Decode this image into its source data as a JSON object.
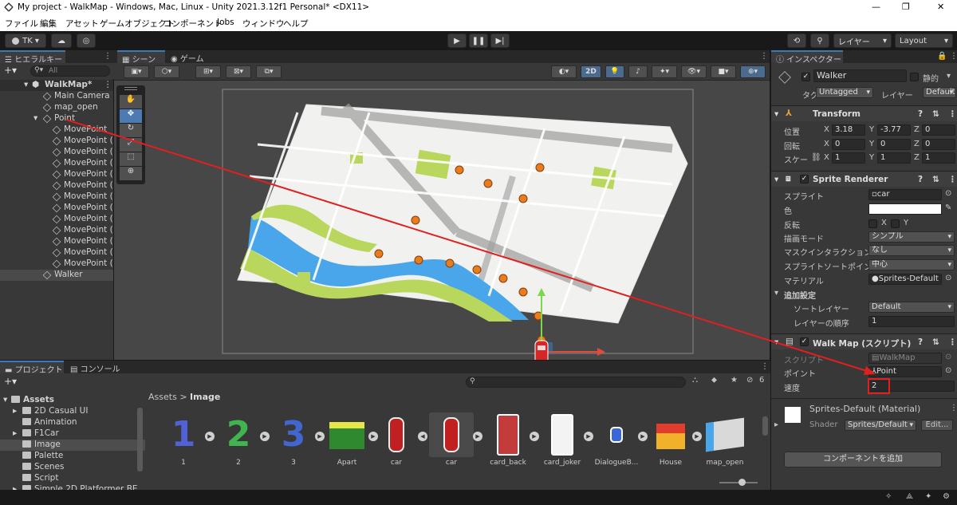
{
  "window": {
    "title": "My project - WalkMap - Windows, Mac, Linux - Unity 2021.3.12f1 Personal* <DX11>",
    "controls": [
      "—",
      "❐",
      "✕"
    ]
  },
  "menu": [
    "ファイル",
    "編集",
    "アセット",
    "ゲームオブジェクト",
    "コンポーネント",
    "Jobs",
    "ウィンドウ",
    "ヘルプ"
  ],
  "toolbar": {
    "account": "TK",
    "layers": "レイヤー",
    "layout": "Layout"
  },
  "hierarchy": {
    "tab": "ヒエラルキー",
    "search_placeholder": "All",
    "scene": "WalkMap*",
    "items": [
      {
        "label": "Main Camera",
        "indent": 1
      },
      {
        "label": "map_open",
        "indent": 1
      },
      {
        "label": "Point",
        "indent": 1
      },
      {
        "label": "MovePoint",
        "indent": 2
      },
      {
        "label": "MovePoint (",
        "indent": 2
      },
      {
        "label": "MovePoint (",
        "indent": 2
      },
      {
        "label": "MovePoint (",
        "indent": 2
      },
      {
        "label": "MovePoint (",
        "indent": 2
      },
      {
        "label": "MovePoint (",
        "indent": 2
      },
      {
        "label": "MovePoint (",
        "indent": 2
      },
      {
        "label": "MovePoint (",
        "indent": 2
      },
      {
        "label": "MovePoint (",
        "indent": 2
      },
      {
        "label": "MovePoint (",
        "indent": 2
      },
      {
        "label": "MovePoint (",
        "indent": 2
      },
      {
        "label": "MovePoint (",
        "indent": 2
      },
      {
        "label": "MovePoint (",
        "indent": 2
      },
      {
        "label": "Walker",
        "indent": 1
      }
    ]
  },
  "scene_view": {
    "tab_scene": "シーン",
    "tab_game": "ゲーム",
    "mode_2d": "2D"
  },
  "inspector": {
    "tab": "インスペクター",
    "object_name": "Walker",
    "static_label": "静的",
    "tag_label": "タグ",
    "tag_value": "Untagged",
    "layer_label": "レイヤー",
    "layer_value": "Default",
    "transform": {
      "title": "Transform",
      "position_label": "位置",
      "rotation_label": "回転",
      "scale_label": "スケー",
      "position": [
        "3.18",
        "-3.77",
        "0"
      ],
      "rotation": [
        "0",
        "0",
        "0"
      ],
      "scale": [
        "1",
        "1",
        "1"
      ],
      "axis": [
        "X",
        "Y",
        "Z"
      ]
    },
    "sprite_renderer": {
      "title": "Sprite Renderer",
      "sprite_label": "スプライト",
      "sprite_value": "car",
      "color_label": "色",
      "color_value": "#ffffff",
      "flip_label": "反転",
      "flip_x": "X",
      "flip_y": "Y",
      "draw_mode_label": "描画モード",
      "draw_mode_value": "シンプル",
      "mask_label": "マスクインタラクション",
      "mask_value": "なし",
      "sort_point_label": "スプライトソートポイント",
      "sort_point_value": "中心",
      "material_label": "マテリアル",
      "material_value": "Sprites-Default",
      "additional_label": "追加設定",
      "sorting_layer_label": "ソートレイヤー",
      "sorting_layer_value": "Default",
      "order_label": "レイヤーの順序",
      "order_value": "1"
    },
    "walkmap": {
      "title": "Walk Map (スクリプト)",
      "script_label": "スクリプト",
      "script_value": "WalkMap",
      "point_label": "ポイント",
      "point_value": "Point",
      "speed_label": "速度",
      "speed_value": "2"
    },
    "material": {
      "name": "Sprites-Default (Material)",
      "shader_label": "Shader",
      "shader_value": "Sprites/Default",
      "edit": "Edit..."
    },
    "add_component": "コンポーネントを追加"
  },
  "project": {
    "tab_project": "プロジェクト",
    "tab_console": "コンソール",
    "root": "Assets",
    "folders": [
      "2D Casual UI",
      "Animation",
      "F1Car",
      "Image",
      "Palette",
      "Scenes",
      "Script",
      "Simple 2D Platformer BE"
    ],
    "breadcrumb_root": "Assets",
    "breadcrumb_current": "Image",
    "hidden_count": "6",
    "assets": [
      "1",
      "2",
      "3",
      "Apart",
      "car",
      "car",
      "card_back",
      "card_joker",
      "DialogueB...",
      "House",
      "map_open"
    ]
  },
  "colors": {
    "accent": "#3a79bb",
    "route_line": "#e0201e",
    "move_point": "#e87d1e",
    "highlight_box": "#e0201e"
  }
}
